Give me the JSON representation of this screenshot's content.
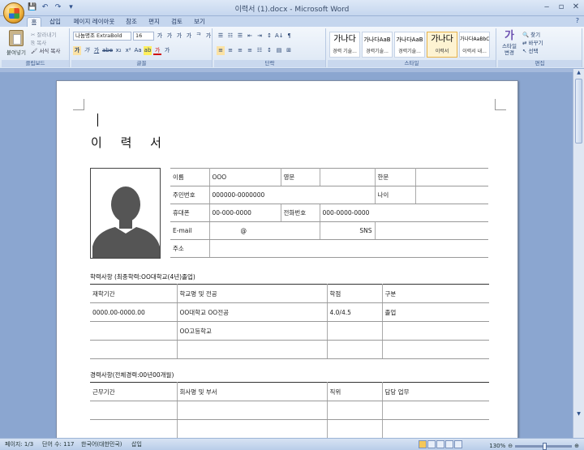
{
  "window": {
    "title": "이력서 (1).docx - Microsoft Word",
    "controls": [
      "‒",
      "▫",
      "✕"
    ]
  },
  "qat": [
    "💾",
    "↶",
    "↷",
    "▾"
  ],
  "tabs": [
    "홈",
    "삽입",
    "페이지 레이아웃",
    "참조",
    "편지",
    "검토",
    "보기"
  ],
  "ribbon": {
    "clipboard": {
      "paste": "붙여넣기",
      "cut": "잘라내기",
      "copy": "복사",
      "format_painter": "서식 복사",
      "label": "클립보드"
    },
    "font": {
      "name": "나눔명조 ExtraBold",
      "size": "16",
      "label": "글꼴",
      "row1": [
        "가",
        "가",
        "가",
        "가",
        "ᄏ",
        "가"
      ],
      "row2": [
        "가",
        "가",
        "가",
        "abe",
        "x₂",
        "x²",
        "Aa",
        "ab",
        "가",
        "가"
      ]
    },
    "paragraph": {
      "label": "단락",
      "row1": [
        "☰",
        "☷",
        "☰",
        "⇤",
        "⇥",
        "↕",
        "A↓",
        "¶"
      ],
      "row2": [
        "≡",
        "≡",
        "≡",
        "≡",
        "☷",
        "↕",
        "▤",
        "⊞"
      ]
    },
    "styles": {
      "label": "스타일",
      "items": [
        {
          "big": "가나다",
          "name": "경력 기술..."
        },
        {
          "big": "가나다AaB",
          "name": "경력기술..."
        },
        {
          "big": "가나다AaB",
          "name": "경력기술..."
        },
        {
          "big": "가나다",
          "name": "이력서"
        },
        {
          "big": "가나다AaBbC",
          "name": "이력서 내..."
        }
      ],
      "change": "스타일 변경"
    },
    "editing": {
      "label": "편집",
      "find": "찾기",
      "replace": "바꾸기",
      "select": "선택"
    }
  },
  "document": {
    "title": "이 력 서",
    "profile": {
      "row1": [
        "이름",
        "OOO",
        "영문",
        "",
        "한문",
        ""
      ],
      "row2": [
        "주민번호",
        "000000-0000000",
        "나이",
        ""
      ],
      "row3": [
        "휴대폰",
        "00-000-0000",
        "전화번호",
        "000-0000-0000"
      ],
      "row4": [
        "E-mail",
        "@",
        "SNS",
        ""
      ],
      "row5": [
        "주소",
        ""
      ]
    },
    "education": {
      "title": "학력사항 (최종학력:OO대학교(4년)졸업)",
      "headers": [
        "재학기간",
        "학교명 및 전공",
        "학점",
        "구분"
      ],
      "rows": [
        [
          "0000.00-0000.00",
          "OO대학교 OO전공",
          "4.0/4.5",
          "졸업"
        ],
        [
          "",
          "OO고등학교",
          "",
          ""
        ],
        [
          "",
          "",
          "",
          ""
        ]
      ]
    },
    "career": {
      "title": "경력사항(전체경력:00년00개월)",
      "headers": [
        "근무기간",
        "회사명 및 부서",
        "직위",
        "담당 업무"
      ],
      "rows": [
        [
          "",
          "",
          "",
          ""
        ],
        [
          "",
          "",
          "",
          ""
        ]
      ]
    }
  },
  "statusbar": {
    "page": "페이지: 1/3",
    "words": "단어 수: 117",
    "language": "한국어(대한민국)",
    "mode": "삽입",
    "zoom": "130%",
    "zoom_level": 0.52
  }
}
